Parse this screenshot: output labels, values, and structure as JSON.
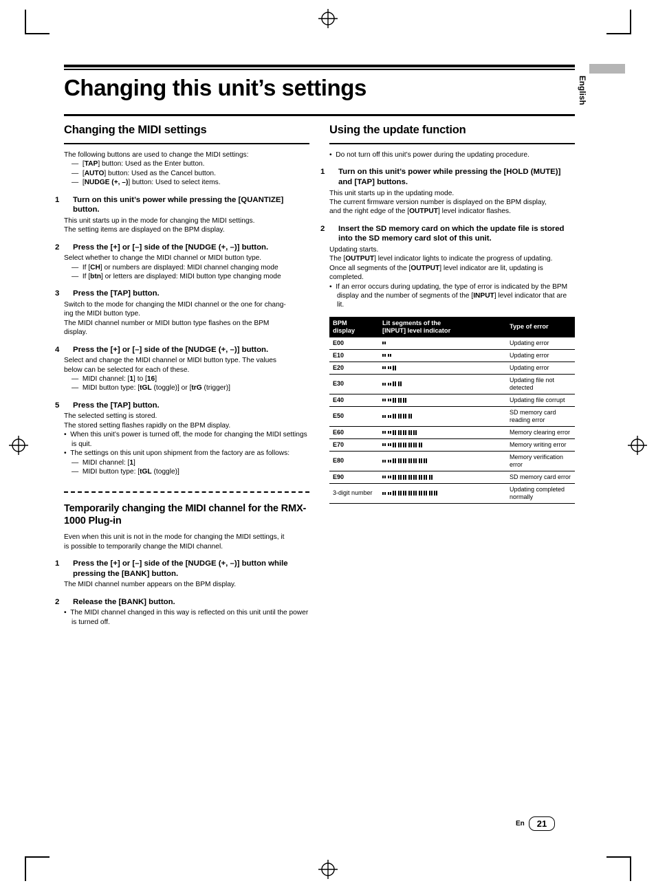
{
  "page": {
    "language_tab": "English",
    "title": "Changing this unit’s settings",
    "footer_label": "En",
    "page_number": "21"
  },
  "left": {
    "section_title": "Changing the MIDI settings",
    "intro": "The following buttons are used to change the MIDI settings:",
    "intro_dashes": [
      "[TAP] button: Used as the Enter button.",
      "[AUTO] button: Used as the Cancel button.",
      "[NUDGE (+, –)] button: Used to select items."
    ],
    "steps": [
      {
        "num": "1",
        "heading": "Turn on this unit’s power while pressing the [QUANTIZE] button.",
        "lines": [
          "This unit starts up in the mode for changing the MIDI settings.",
          "The setting items are displayed on the BPM display."
        ],
        "dashes": []
      },
      {
        "num": "2",
        "heading": "Press the [+] or [–] side of the [NUDGE (+, –)] button.",
        "lines": [
          "Select whether to change the MIDI channel or MIDI button type."
        ],
        "dashes": [
          "If [CH] or numbers are displayed: MIDI channel changing mode",
          "If [btn] or letters are displayed: MIDI button type changing mode"
        ]
      },
      {
        "num": "3",
        "heading": "Press the [TAP] button.",
        "lines": [
          "Switch to the mode for changing the MIDI channel or the one for chang-",
          "ing the MIDI button type.",
          "The MIDI channel number or MIDI button type flashes on the BPM",
          "display."
        ],
        "dashes": []
      },
      {
        "num": "4",
        "heading": "Press the [+] or [–] side of the [NUDGE (+, –)] button.",
        "lines": [
          "Select and change the MIDI channel or MIDI button type. The values",
          "below can be selected for each of these."
        ],
        "dashes": [
          "MIDI channel: [1] to [16]",
          "MIDI button type: [tGL (toggle)] or [trG (trigger)]"
        ]
      },
      {
        "num": "5",
        "heading": "Press the [TAP] button.",
        "lines": [
          "The selected setting is stored.",
          "The stored setting flashes rapidly on the BPM display."
        ],
        "dashes": []
      }
    ],
    "bullets_after": [
      "When this unit’s power is turned off, the mode for changing the MIDI settings is quit.",
      "The settings on this unit upon shipment from the factory are as follows:"
    ],
    "factory_dashes": [
      "MIDI channel: [1]",
      "MIDI button type: [tGL (toggle)]"
    ],
    "sub_title": "Temporarily changing the MIDI channel for the RMX-1000 Plug-in",
    "sub_body": [
      "Even when this unit is not in the mode for changing the MIDI settings, it",
      "is possible to temporarily change the MIDI channel."
    ],
    "sub_steps": [
      {
        "num": "1",
        "heading": "Press the [+] or [–] side of the [NUDGE (+, –)] button while pressing the [BANK] button.",
        "lines": [
          "The MIDI channel number appears on the BPM display."
        ],
        "bullets": []
      },
      {
        "num": "2",
        "heading": "Release the [BANK] button.",
        "lines": [],
        "bullets": [
          "The MIDI channel changed in this way is reflected on this unit until the power is turned off."
        ]
      }
    ]
  },
  "right": {
    "section_title": "Using the update function",
    "top_bullet": "Do not turn off this unit’s power during the updating procedure.",
    "steps": [
      {
        "num": "1",
        "heading": "Turn on this unit’s power while pressing the [HOLD (MUTE)] and [TAP] buttons.",
        "lines": [
          "This unit starts up in the updating mode.",
          "The current firmware version number is displayed on the BPM display,",
          "and the right edge of the [OUTPUT] level indicator flashes."
        ],
        "bullets": []
      },
      {
        "num": "2",
        "heading": "Insert the SD memory card on which the update file is stored into the SD memory card slot of this unit.",
        "lines": [
          "Updating starts.",
          "The [OUTPUT] level indicator lights to indicate the progress of updating.",
          "Once all segments of the [OUTPUT] level indicator are lit, updating is",
          "completed."
        ],
        "bullets": [
          "If an error occurs during updating, the type of error is indicated by the BPM display and the number of segments of the [INPUT] level indicator that are lit."
        ]
      }
    ],
    "table": {
      "headers": [
        "BPM display",
        "Lit segments of the [INPUT] level indicator",
        "Type of error"
      ],
      "rows": [
        {
          "bpm": "E00",
          "segments": 2,
          "type": "Updating error"
        },
        {
          "bpm": "E10",
          "segments": 4,
          "type": "Updating error"
        },
        {
          "bpm": "E20",
          "segments": 6,
          "type": "Updating error"
        },
        {
          "bpm": "E30",
          "segments": 8,
          "type": "Updating file not detected"
        },
        {
          "bpm": "E40",
          "segments": 10,
          "type": "Updating file corrupt"
        },
        {
          "bpm": "E50",
          "segments": 12,
          "type": "SD memory card reading error"
        },
        {
          "bpm": "E60",
          "segments": 14,
          "type": "Memory clearing error"
        },
        {
          "bpm": "E70",
          "segments": 16,
          "type": "Memory writing error"
        },
        {
          "bpm": "E80",
          "segments": 18,
          "type": "Memory verification error"
        },
        {
          "bpm": "E90",
          "segments": 20,
          "type": "SD memory card error"
        },
        {
          "bpm": "3-digit number",
          "segments": 22,
          "type": "Updating completed normally"
        }
      ]
    }
  }
}
